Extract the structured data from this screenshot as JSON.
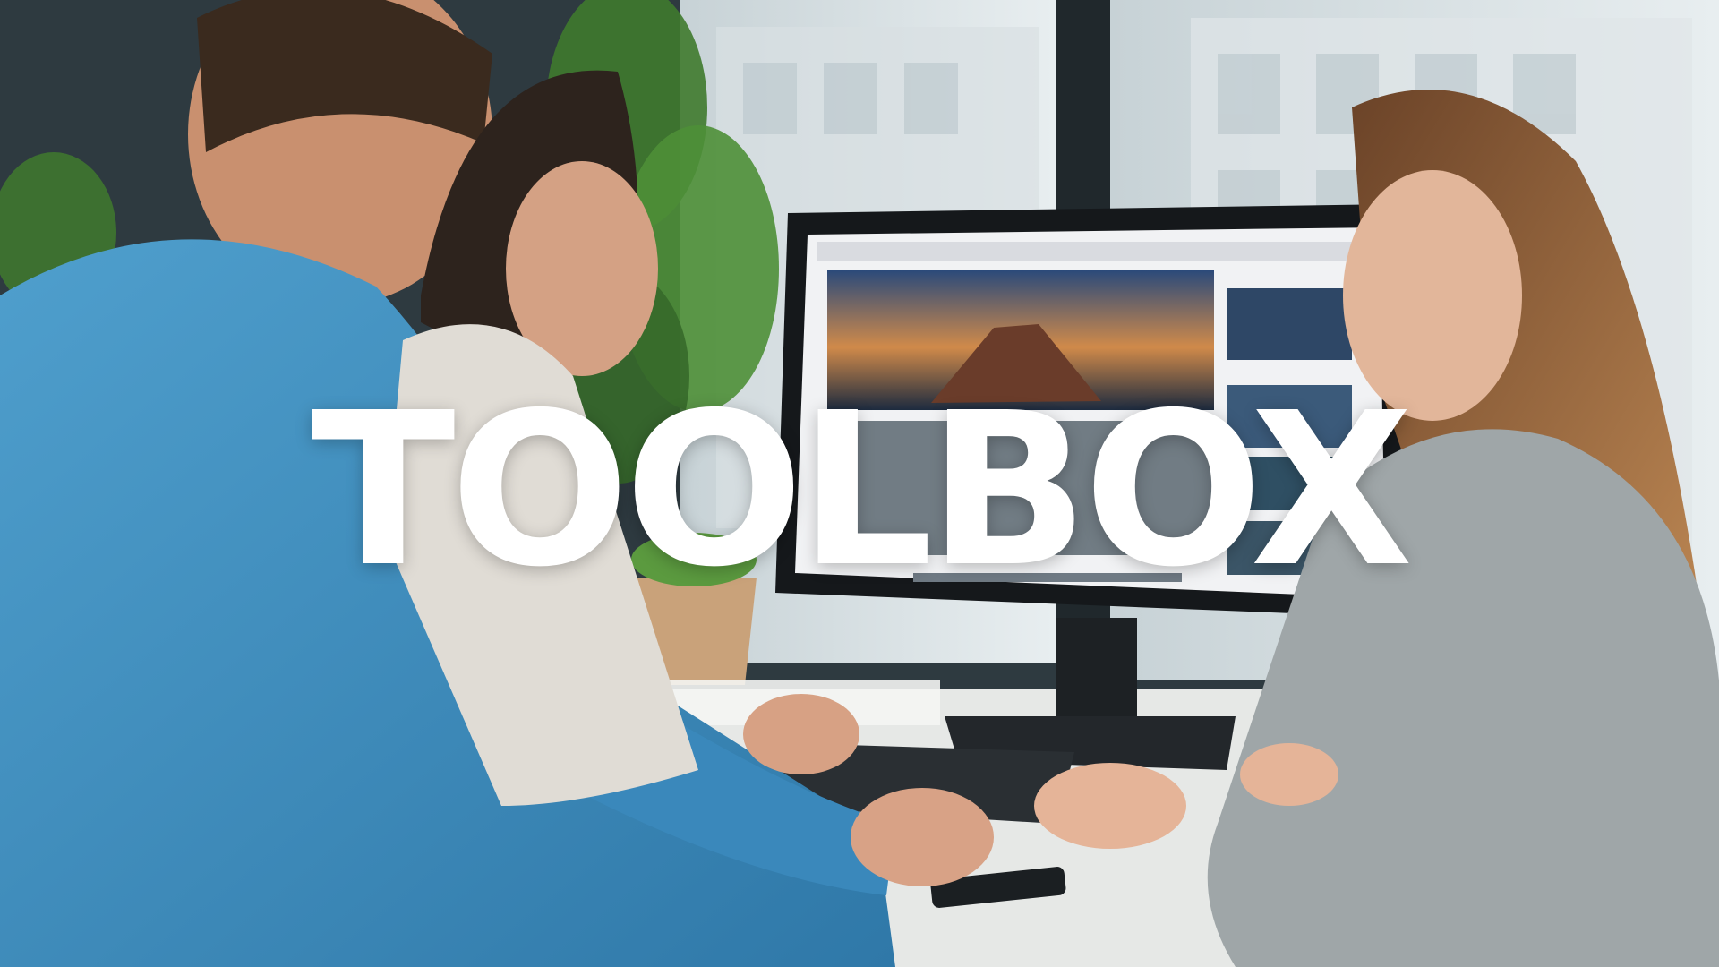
{
  "title": "TOOLBOX",
  "colors": {
    "window_light": "#e9eef0",
    "wall_dark": "#28343a",
    "shirt_blue": "#3f8fc0",
    "sweater_grey": "#9fa6a8",
    "monitor_black": "#15181b",
    "desk": "#e6e8e6",
    "plant_green": "#3f7a2e",
    "title_white": "#ffffff"
  },
  "icons": [
    "plant-icon",
    "monitor-icon",
    "keyboard-icon",
    "phone-icon",
    "mountain-icon"
  ]
}
